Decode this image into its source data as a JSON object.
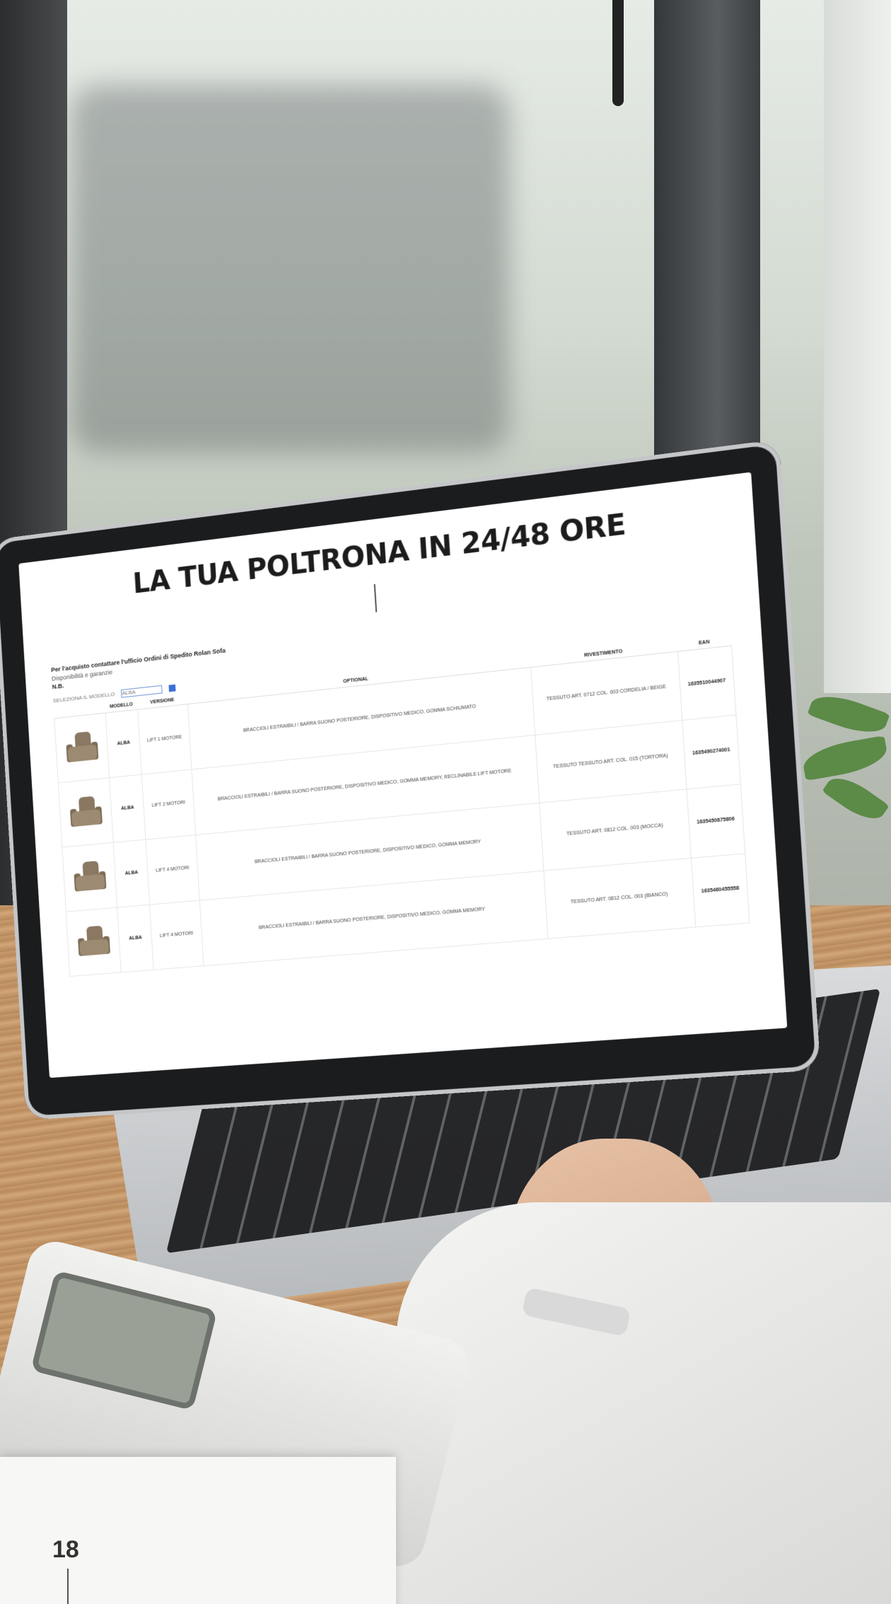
{
  "screen": {
    "title": "LA TUA POLTRONA IN 24/48 ORE",
    "intro_line1": "Per l'acquisto contattare l'ufficio Ordini di Spedito Rolan Sofa",
    "intro_line2": "Disponibilità e garanzie",
    "nb_label": "N.B.",
    "filter_label": "SELEZIONA IL MODELLO",
    "filter_value": "ALBA",
    "table": {
      "headers": [
        "",
        "MODELLO",
        "VERSIONE",
        "OPTIONAL",
        "RIVESTIMENTO",
        "EAN"
      ],
      "rows": [
        {
          "model": "ALBA",
          "version": "LIFT 1 MOTORE",
          "optional": "BRACCIOLI ESTRAIBILI / BARRA SUONO POSTERIORE, DISPOSITIVO MEDICO, GOMMA SCHIUMATO",
          "covering": "TESSUTO ART. 0712 COL. 003 CORDELIA / BEIGE",
          "code": "1635510044907"
        },
        {
          "model": "ALBA",
          "version": "LIFT 2 MOTORI",
          "optional": "BRACCIOLI ESTRAIBILI / BARRA SUONO POSTERIORE, DISPOSITIVO MEDICO, GOMMA MEMORY, RECLINABILE LIFT MOTORE",
          "covering": "TESSUTO TESSUTO ART. COL. 015 (TORTORA)",
          "code": "1635490274001"
        },
        {
          "model": "ALBA",
          "version": "LIFT 4 MOTORI",
          "optional": "BRACCIOLI ESTRAIBILI / BARRA SUONO POSTERIORE, DISPOSITIVO MEDICO, GOMMA MEMORY",
          "covering": "TESSUTO ART. 0812 COL. 003 (MOCCA)",
          "code": "1635450875806"
        },
        {
          "model": "ALBA",
          "version": "LIFT 4 MOTORI",
          "optional": "BRACCIOLI ESTRAIBILI / BARRA SUONO POSTERIORE, DISPOSITIVO MEDICO, GOMMA MEMORY",
          "covering": "TESSUTO ART. 0812 COL. 003 (BIANCO)",
          "code": "1635460455558"
        }
      ]
    }
  },
  "page_number": "18",
  "colors": {
    "desk": "#c89b6d",
    "laptop_frame": "#1b1c1e",
    "chair": "#8a7862"
  }
}
